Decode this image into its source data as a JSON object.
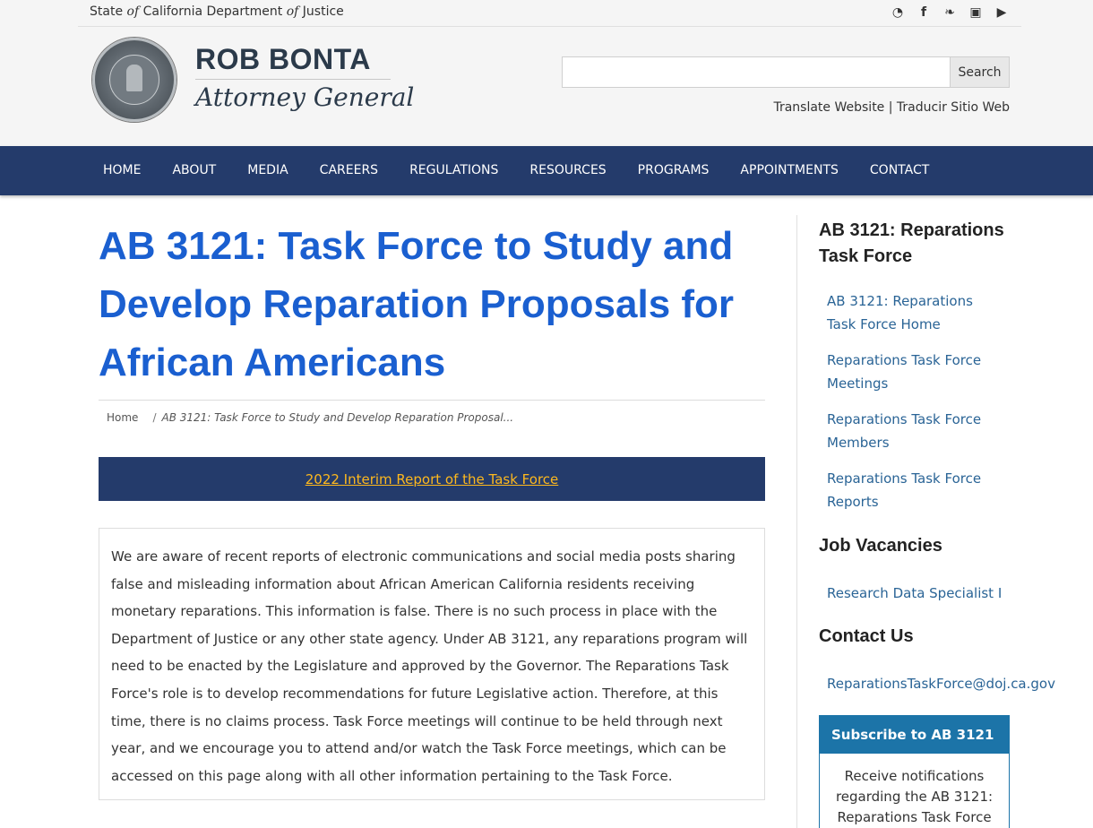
{
  "topbar": {
    "prefix": "State ",
    "of1": "of",
    "middle": " California Department ",
    "of2": "of",
    "suffix": " Justice",
    "social": [
      {
        "icon": "rss-icon",
        "glyph": "◔"
      },
      {
        "icon": "facebook-icon",
        "glyph": "f"
      },
      {
        "icon": "twitter-icon",
        "glyph": "❧"
      },
      {
        "icon": "instagram-icon",
        "glyph": "▣"
      },
      {
        "icon": "youtube-icon",
        "glyph": "▶"
      }
    ]
  },
  "brand": {
    "name": "ROB BONTA",
    "title": "Attorney General"
  },
  "search": {
    "placeholder": "",
    "button": "Search"
  },
  "translate": {
    "english": "Translate Website",
    "separator": " | ",
    "spanish": "Traducir Sitio Web"
  },
  "nav": [
    "HOME",
    "ABOUT",
    "MEDIA",
    "CAREERS",
    "REGULATIONS",
    "RESOURCES",
    "PROGRAMS",
    "APPOINTMENTS",
    "CONTACT"
  ],
  "main": {
    "title": "AB 3121: Task Force to Study and Develop Reparation Proposals for African Americans",
    "breadcrumb": {
      "home": "Home",
      "separator": "/",
      "current": "AB 3121: Task Force to Study and Develop Reparation Proposal..."
    },
    "banner_link": "2022 Interim Report of the Task Force",
    "notice": "We are aware of recent reports of electronic communications and social media posts sharing false and misleading information about African American California residents receiving monetary reparations. This information is false. There is no such process in place with the Department of Justice or any other state agency. Under AB 3121, any reparations program will need to be enacted by the Legislature and approved by the Governor. The Reparations Task Force's role is to develop recommendations for future Legislative action. Therefore, at this time, there is no claims process. Task Force meetings will continue to be held through next year, and we encourage you to attend and/or watch the Task Force meetings, which can be accessed on this page along with all other information pertaining to the Task Force."
  },
  "sidebar": {
    "section_title": "AB 3121: Reparations Task Force",
    "links": [
      "AB 3121: Reparations Task Force Home",
      "Reparations Task Force Meetings",
      "Reparations Task Force Members",
      "Reparations Task Force Reports"
    ],
    "jobs_title": "Job Vacancies",
    "jobs": [
      "Research Data Specialist I"
    ],
    "contact_title": "Contact Us",
    "contact_email": "ReparationsTaskForce@doj.ca.gov",
    "subscribe_title": "Subscribe to AB 3121",
    "subscribe_text": "Receive notifications regarding the AB 3121: Reparations Task Force"
  },
  "colors": {
    "nav_bg": "#243b6b",
    "title": "#1a5fd0",
    "link": "#2a6496",
    "banner_link": "#fdb81e",
    "subscribe": "#1c74a8"
  }
}
